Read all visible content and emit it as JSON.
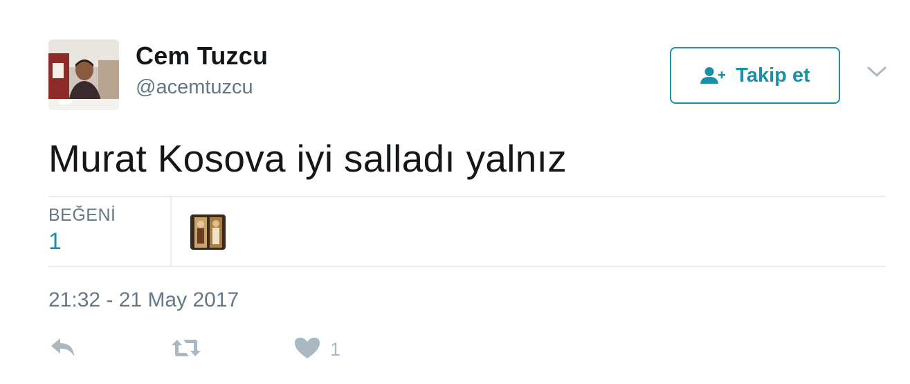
{
  "author": {
    "display_name": "Cem Tuzcu",
    "handle": "@acemtuzcu",
    "avatar_icon": "user-photo"
  },
  "follow_button": {
    "label": "Takip et",
    "icon": "add-user-icon",
    "color": "#1b8fa8"
  },
  "more_menu": {
    "icon": "chevron-down-icon"
  },
  "tweet": {
    "text": "Murat Kosova iyi salladı yalnız",
    "timestamp": "21:32 - 21 May 2017"
  },
  "stats": {
    "likes_label": "BEĞENİ",
    "likes_count": "1"
  },
  "actions": {
    "reply_icon": "reply-icon",
    "retweet_icon": "retweet-icon",
    "like_icon": "heart-icon",
    "like_count": "1"
  },
  "colors": {
    "accent": "#1b8fa8",
    "muted": "#657786",
    "action_gray": "#aab8c2",
    "divider": "#e6ecf0"
  }
}
